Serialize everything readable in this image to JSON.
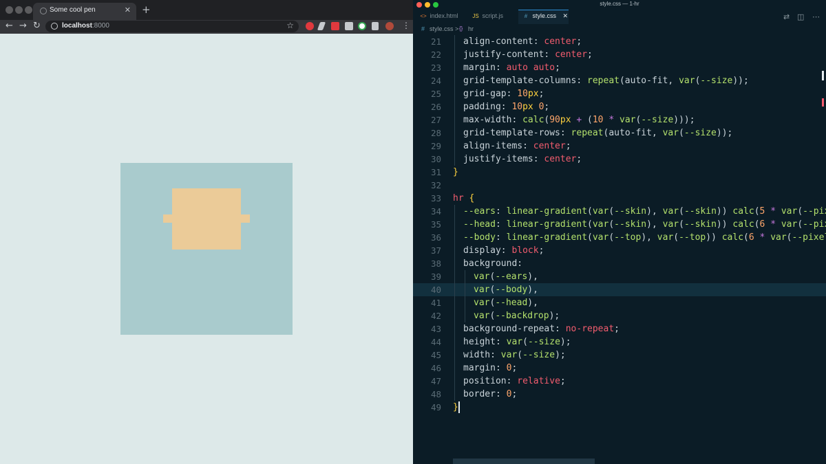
{
  "browser": {
    "tab_title": "Some cool pen",
    "tab_close": "✕",
    "new_tab": "+",
    "url_host": "localhost",
    "url_port": ":8000",
    "nav": {
      "back": "←",
      "forward": "→",
      "reload": "↻",
      "star": "☆"
    }
  },
  "art": {
    "backdrop": "#a9cbcd",
    "skin": "#ebcb98",
    "page_bg": "#dde9e9"
  },
  "editor": {
    "window_title": "style.css — 1-hr",
    "tabs": [
      {
        "icon": "<>",
        "label": "index.html"
      },
      {
        "icon": "JS",
        "label": "script.js"
      },
      {
        "icon": "#",
        "label": "style.css",
        "close": "✕"
      }
    ],
    "breadcrumb": {
      "file_icon": "#",
      "file": "style.css",
      "sep": ">",
      "symbol_icon": "{}",
      "symbol": "hr"
    }
  },
  "code": [
    {
      "n": "21",
      "tokens": [
        [
          "t-prop",
          "align-content: "
        ],
        [
          "t-kw",
          "center"
        ],
        [
          "t-prop",
          ";"
        ]
      ]
    },
    {
      "n": "22",
      "tokens": [
        [
          "t-prop",
          "justify-content: "
        ],
        [
          "t-kw",
          "center"
        ],
        [
          "t-prop",
          ";"
        ]
      ]
    },
    {
      "n": "23",
      "tokens": [
        [
          "t-prop",
          "margin: "
        ],
        [
          "t-kw",
          "auto auto"
        ],
        [
          "t-prop",
          ";"
        ]
      ]
    },
    {
      "n": "24",
      "tokens": [
        [
          "t-prop",
          "grid-template-columns: "
        ],
        [
          "t-fn",
          "repeat"
        ],
        [
          "t-prop",
          "(auto-fit, "
        ],
        [
          "t-fn",
          "var"
        ],
        [
          "t-prop",
          "("
        ],
        [
          "t-var",
          "--size"
        ],
        [
          "t-prop",
          "));"
        ]
      ]
    },
    {
      "n": "25",
      "tokens": [
        [
          "t-prop",
          "grid-gap: "
        ],
        [
          "t-num",
          "10"
        ],
        [
          "t-unit",
          "px"
        ],
        [
          "t-prop",
          ";"
        ]
      ]
    },
    {
      "n": "26",
      "tokens": [
        [
          "t-prop",
          "padding: "
        ],
        [
          "t-num",
          "10"
        ],
        [
          "t-unit",
          "px"
        ],
        [
          "t-prop",
          " "
        ],
        [
          "t-num",
          "0"
        ],
        [
          "t-prop",
          ";"
        ]
      ]
    },
    {
      "n": "27",
      "tokens": [
        [
          "t-prop",
          "max-width: "
        ],
        [
          "t-fn",
          "calc"
        ],
        [
          "t-prop",
          "("
        ],
        [
          "t-num",
          "90"
        ],
        [
          "t-unit",
          "px"
        ],
        [
          "t-prop",
          " "
        ],
        [
          "t-op",
          "+"
        ],
        [
          "t-prop",
          " ("
        ],
        [
          "t-num",
          "10"
        ],
        [
          "t-prop",
          " "
        ],
        [
          "t-op",
          "*"
        ],
        [
          "t-prop",
          " "
        ],
        [
          "t-fn",
          "var"
        ],
        [
          "t-prop",
          "("
        ],
        [
          "t-var",
          "--size"
        ],
        [
          "t-prop",
          ")));"
        ]
      ]
    },
    {
      "n": "28",
      "tokens": [
        [
          "t-prop",
          "grid-template-rows: "
        ],
        [
          "t-fn",
          "repeat"
        ],
        [
          "t-prop",
          "(auto-fit, "
        ],
        [
          "t-fn",
          "var"
        ],
        [
          "t-prop",
          "("
        ],
        [
          "t-var",
          "--size"
        ],
        [
          "t-prop",
          "));"
        ]
      ]
    },
    {
      "n": "29",
      "tokens": [
        [
          "t-prop",
          "align-items: "
        ],
        [
          "t-kw",
          "center"
        ],
        [
          "t-prop",
          ";"
        ]
      ]
    },
    {
      "n": "30",
      "tokens": [
        [
          "t-prop",
          "justify-items: "
        ],
        [
          "t-kw",
          "center"
        ],
        [
          "t-prop",
          ";"
        ]
      ]
    },
    {
      "n": "31",
      "tokens": [
        [
          "t-br",
          "}"
        ]
      ]
    },
    {
      "n": "32",
      "tokens": []
    },
    {
      "n": "33",
      "tokens": [
        [
          "t-sel",
          "hr"
        ],
        [
          "t-prop",
          " "
        ],
        [
          "t-br",
          "{"
        ]
      ]
    },
    {
      "n": "34",
      "tokens": [
        [
          "t-var",
          "--ears"
        ],
        [
          "t-prop",
          ": "
        ],
        [
          "t-fn",
          "linear-gradient"
        ],
        [
          "t-prop",
          "("
        ],
        [
          "t-fn",
          "var"
        ],
        [
          "t-prop",
          "("
        ],
        [
          "t-var",
          "--skin"
        ],
        [
          "t-prop",
          "), "
        ],
        [
          "t-fn",
          "var"
        ],
        [
          "t-prop",
          "("
        ],
        [
          "t-var",
          "--skin"
        ],
        [
          "t-prop",
          ")) "
        ],
        [
          "t-fn",
          "calc"
        ],
        [
          "t-prop",
          "("
        ],
        [
          "t-num",
          "5"
        ],
        [
          "t-prop",
          " "
        ],
        [
          "t-op",
          "*"
        ],
        [
          "t-prop",
          " "
        ],
        [
          "t-fn",
          "var"
        ],
        [
          "t-prop",
          "("
        ],
        [
          "t-var",
          "--pixel"
        ]
      ]
    },
    {
      "n": "35",
      "tokens": [
        [
          "t-var",
          "--head"
        ],
        [
          "t-prop",
          ": "
        ],
        [
          "t-fn",
          "linear-gradient"
        ],
        [
          "t-prop",
          "("
        ],
        [
          "t-fn",
          "var"
        ],
        [
          "t-prop",
          "("
        ],
        [
          "t-var",
          "--skin"
        ],
        [
          "t-prop",
          "), "
        ],
        [
          "t-fn",
          "var"
        ],
        [
          "t-prop",
          "("
        ],
        [
          "t-var",
          "--skin"
        ],
        [
          "t-prop",
          ")) "
        ],
        [
          "t-fn",
          "calc"
        ],
        [
          "t-prop",
          "("
        ],
        [
          "t-num",
          "6"
        ],
        [
          "t-prop",
          " "
        ],
        [
          "t-op",
          "*"
        ],
        [
          "t-prop",
          " "
        ],
        [
          "t-fn",
          "var"
        ],
        [
          "t-prop",
          "("
        ],
        [
          "t-var",
          "--pixel"
        ],
        [
          "t-prop",
          ")"
        ]
      ]
    },
    {
      "n": "36",
      "tokens": [
        [
          "t-var",
          "--body"
        ],
        [
          "t-prop",
          ": "
        ],
        [
          "t-fn",
          "linear-gradient"
        ],
        [
          "t-prop",
          "("
        ],
        [
          "t-fn",
          "var"
        ],
        [
          "t-prop",
          "("
        ],
        [
          "t-var",
          "--top"
        ],
        [
          "t-prop",
          "), "
        ],
        [
          "t-fn",
          "var"
        ],
        [
          "t-prop",
          "("
        ],
        [
          "t-var",
          "--top"
        ],
        [
          "t-prop",
          ")) "
        ],
        [
          "t-fn",
          "calc"
        ],
        [
          "t-prop",
          "("
        ],
        [
          "t-num",
          "6"
        ],
        [
          "t-prop",
          " "
        ],
        [
          "t-op",
          "*"
        ],
        [
          "t-prop",
          " "
        ],
        [
          "t-fn",
          "var"
        ],
        [
          "t-prop",
          "("
        ],
        [
          "t-var",
          "--pixel"
        ],
        [
          "t-prop",
          ")"
        ]
      ]
    },
    {
      "n": "37",
      "tokens": [
        [
          "t-prop",
          "display: "
        ],
        [
          "t-kw",
          "block"
        ],
        [
          "t-prop",
          ";"
        ]
      ]
    },
    {
      "n": "38",
      "tokens": [
        [
          "t-prop",
          "background:"
        ]
      ]
    },
    {
      "n": "39",
      "tokens": [
        [
          "t-fn",
          "var"
        ],
        [
          "t-prop",
          "("
        ],
        [
          "t-var",
          "--ears"
        ],
        [
          "t-prop",
          "),"
        ]
      ]
    },
    {
      "n": "40",
      "tokens": [
        [
          "t-fn",
          "var"
        ],
        [
          "t-prop",
          "("
        ],
        [
          "t-var",
          "--body"
        ],
        [
          "t-prop",
          "),"
        ]
      ]
    },
    {
      "n": "41",
      "tokens": [
        [
          "t-fn",
          "var"
        ],
        [
          "t-prop",
          "("
        ],
        [
          "t-var",
          "--head"
        ],
        [
          "t-prop",
          "),"
        ]
      ]
    },
    {
      "n": "42",
      "tokens": [
        [
          "t-fn",
          "var"
        ],
        [
          "t-prop",
          "("
        ],
        [
          "t-var",
          "--backdrop"
        ],
        [
          "t-prop",
          ");"
        ]
      ]
    },
    {
      "n": "43",
      "tokens": [
        [
          "t-prop",
          "background-repeat: "
        ],
        [
          "t-kw",
          "no-repeat"
        ],
        [
          "t-prop",
          ";"
        ]
      ]
    },
    {
      "n": "44",
      "tokens": [
        [
          "t-prop",
          "height: "
        ],
        [
          "t-fn",
          "var"
        ],
        [
          "t-prop",
          "("
        ],
        [
          "t-var",
          "--size"
        ],
        [
          "t-prop",
          ");"
        ]
      ]
    },
    {
      "n": "45",
      "tokens": [
        [
          "t-prop",
          "width: "
        ],
        [
          "t-fn",
          "var"
        ],
        [
          "t-prop",
          "("
        ],
        [
          "t-var",
          "--size"
        ],
        [
          "t-prop",
          ");"
        ]
      ]
    },
    {
      "n": "46",
      "tokens": [
        [
          "t-prop",
          "margin: "
        ],
        [
          "t-num",
          "0"
        ],
        [
          "t-prop",
          ";"
        ]
      ]
    },
    {
      "n": "47",
      "tokens": [
        [
          "t-prop",
          "position: "
        ],
        [
          "t-kw",
          "relative"
        ],
        [
          "t-prop",
          ";"
        ]
      ]
    },
    {
      "n": "48",
      "tokens": [
        [
          "t-prop",
          "border: "
        ],
        [
          "t-num",
          "0"
        ],
        [
          "t-prop",
          ";"
        ]
      ]
    },
    {
      "n": "49",
      "tokens": [
        [
          "t-br",
          "}"
        ]
      ]
    }
  ]
}
